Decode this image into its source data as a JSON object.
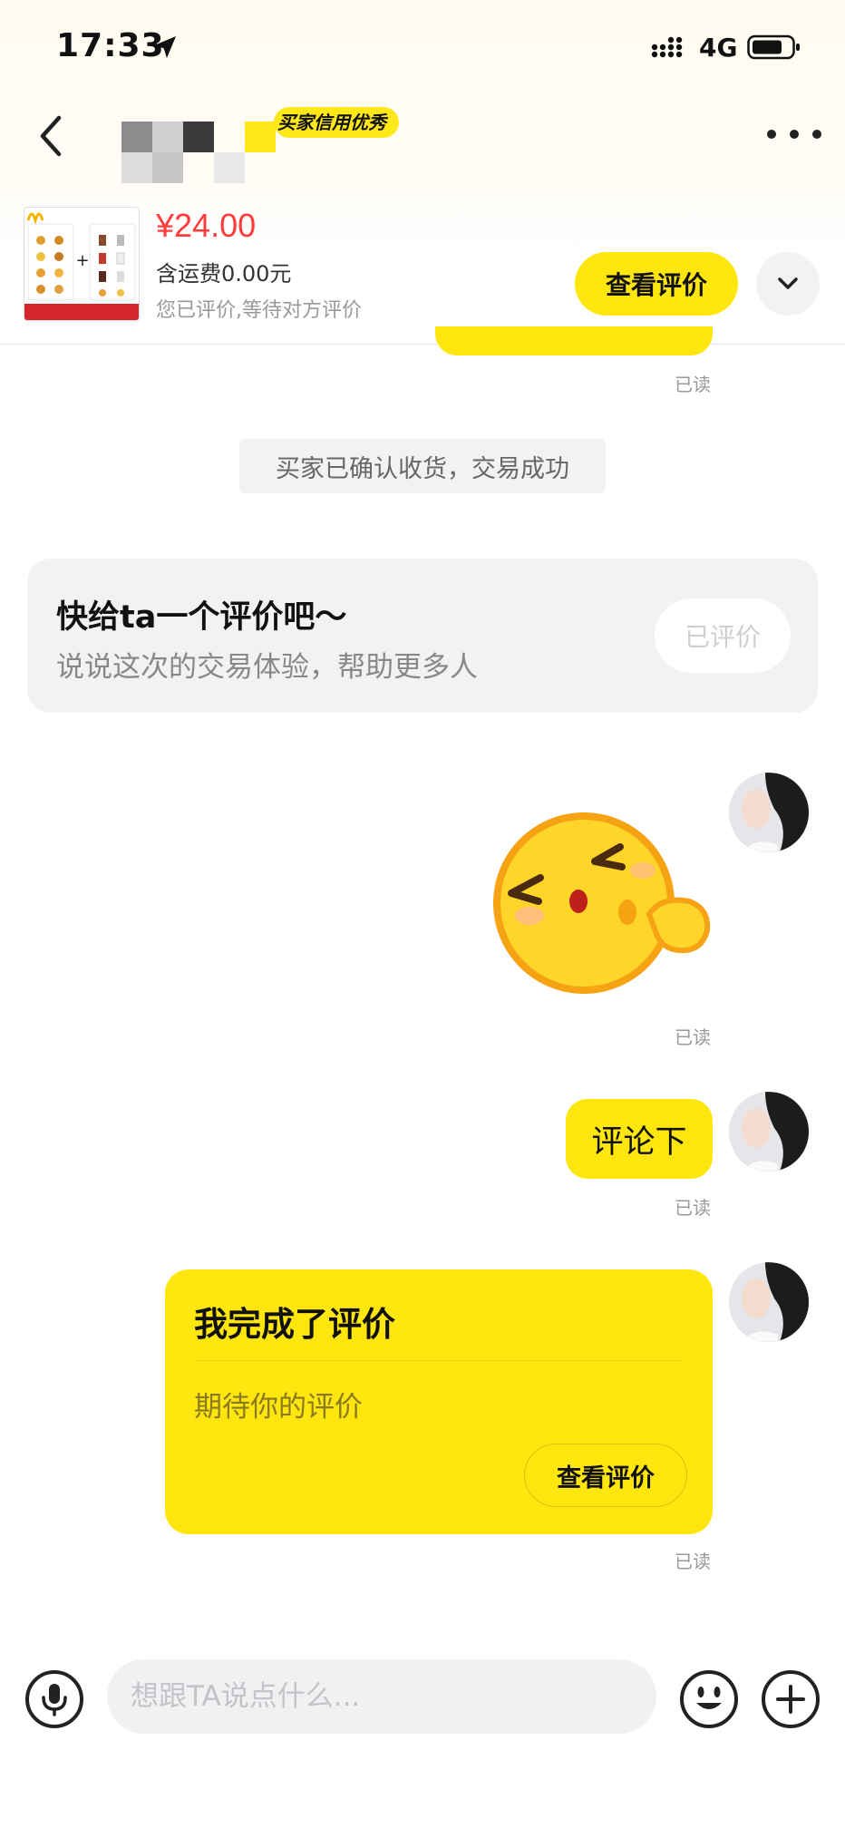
{
  "status_bar": {
    "time": "17:33",
    "network": "4G",
    "icons": [
      "location-arrow-icon",
      "signal-icon",
      "battery-icon"
    ]
  },
  "header": {
    "credit_badge": "买家信用优秀",
    "more_icon": "more-dots-icon",
    "back_icon": "chevron-left-icon"
  },
  "product": {
    "price": "¥24.00",
    "shipping": "含运费0.00元",
    "status": "您已评价,等待对方评价",
    "view_review_label": "查看评价",
    "expand_icon": "chevron-down-icon"
  },
  "chat": {
    "read_label": "已读",
    "system_message": "买家已确认收货，交易成功",
    "review_prompt": {
      "title": "快给ta一个评价吧～",
      "subtitle": "说说这次的交易体验，帮助更多人",
      "button_label": "已评价"
    },
    "text_message": "评论下",
    "review_card": {
      "title": "我完成了评价",
      "subtitle": "期待你的评价",
      "button_label": "查看评价"
    }
  },
  "input_bar": {
    "placeholder": "想跟TA说点什么..."
  },
  "colors": {
    "accent": "#ffe60f",
    "price": "#ff3b3b",
    "muted": "#999999"
  }
}
